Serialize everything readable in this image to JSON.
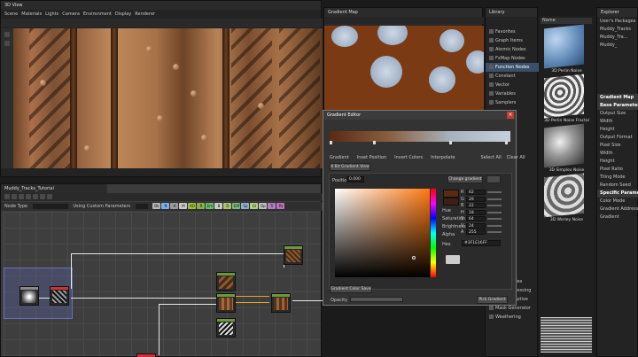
{
  "view3d": {
    "title": "3D View",
    "menu": [
      "Scene",
      "Materials",
      "Lights",
      "Camera",
      "Environment",
      "Display",
      "Renderer"
    ]
  },
  "graph": {
    "title": "Muddy_Tracks_Tutorial",
    "mode_label": "Node Type",
    "params_label": "Using Custom Parameters",
    "chips": [
      {
        "label": "Bb",
        "color": "#b7b7b7"
      },
      {
        "label": "N",
        "color": "#7ab0e8"
      },
      {
        "label": "H",
        "color": "#9b9b9b"
      },
      {
        "label": "M",
        "color": "#c9c9c9"
      },
      {
        "label": "AO",
        "color": "#a0c040"
      },
      {
        "label": "R",
        "color": "#8ab04a"
      },
      {
        "label": "Em",
        "color": "#6dbf6d"
      },
      {
        "label": "B",
        "color": "#c8c8c8"
      },
      {
        "label": "D",
        "color": "#a6c56e"
      },
      {
        "label": "Diff",
        "color": "#7dbb7d"
      },
      {
        "label": "Sp",
        "color": "#90b0d0"
      },
      {
        "label": "Gl",
        "color": "#b0d080"
      },
      {
        "label": "Op",
        "color": "#c0c0c0"
      },
      {
        "label": "Tr",
        "color": "#b080c0"
      },
      {
        "label": "Pa",
        "color": "#c070c0"
      }
    ]
  },
  "gradient_map": {
    "title": "Gradient Map"
  },
  "dialog": {
    "title": "Gradient Editor",
    "tabs": [
      "Gradient",
      "Inset Position",
      "Invert Colors",
      "Interpolate"
    ],
    "right_buttons": [
      "Select All",
      "Clear All"
    ],
    "hdr_button": "8 Bit Gradient View",
    "position_label": "Position",
    "position_value": "0.000",
    "copy_button": "Change gradient color",
    "rows": [
      {
        "label": "R",
        "value": "62"
      },
      {
        "label": "G",
        "value": "29"
      },
      {
        "label": "B",
        "value": "22"
      },
      {
        "label": "H",
        "value": "18"
      },
      {
        "label": "S",
        "value": "64"
      },
      {
        "label": "V",
        "value": "24"
      },
      {
        "label": "A",
        "value": "255"
      }
    ],
    "side_labels": [
      "Hue",
      "Saturation",
      "Brightness",
      "Alpha"
    ],
    "hex_label": "Hex",
    "hex_value": "#3F1E16FF",
    "save_button": "Gradient Color Save",
    "pick_button": "Pick Gradient",
    "slider_label": "Opacity"
  },
  "library": {
    "title": "Library",
    "items": [
      {
        "label": "Favorites",
        "hl": false
      },
      {
        "label": "Graph Items",
        "hl": false
      },
      {
        "label": "Atomic Nodes",
        "hl": false
      },
      {
        "label": "FxMap Nodes",
        "hl": false
      },
      {
        "label": "Function Nodes",
        "hl": true
      },
      {
        "label": "Constant",
        "hl": false
      },
      {
        "label": "Vector",
        "hl": false
      },
      {
        "label": "Variables",
        "hl": false
      },
      {
        "label": "Samplers",
        "hl": false
      },
      {
        "label": "PBR Utilities",
        "hl": false
      },
      {
        "label": "Scan Processing",
        "hl": false
      },
      {
        "label": "Mesh Adaptive",
        "hl": false
      },
      {
        "label": "Mask Generator",
        "hl": false
      },
      {
        "label": "Weathering",
        "hl": false
      }
    ],
    "search_label": "Name",
    "thumbs": [
      {
        "label": "3D Perlin Noise"
      },
      {
        "label": "3D Perlin Noise Fractal"
      },
      {
        "label": "3D Simplex Noise"
      },
      {
        "label": "3D Worley Noise"
      }
    ]
  },
  "explorer": {
    "title": "Explorer",
    "rows": [
      {
        "label": "User's Packages",
        "sec": false
      },
      {
        "label": "Muddy_Tracks",
        "sec": false
      },
      {
        "label": "Muddy_Tra...",
        "sec": false
      },
      {
        "label": "Muddy_",
        "sec": false
      },
      {
        "label": "Gradient Map",
        "sec": true
      },
      {
        "label": "Base Parameters",
        "sec": true
      },
      {
        "label": "Output Size",
        "sec": false
      },
      {
        "label": "Width",
        "sec": false
      },
      {
        "label": "Height",
        "sec": false
      },
      {
        "label": "Output Format",
        "sec": false
      },
      {
        "label": "Pixel Size",
        "sec": false
      },
      {
        "label": "Width",
        "sec": false
      },
      {
        "label": "Height",
        "sec": false
      },
      {
        "label": "Pixel Ratio",
        "sec": false
      },
      {
        "label": "Tiling Mode",
        "sec": false
      },
      {
        "label": "Random Seed",
        "sec": false
      },
      {
        "label": "Specific Parameters",
        "sec": true
      },
      {
        "label": "Color Mode",
        "sec": false
      },
      {
        "label": "Gradient Address",
        "sec": false
      },
      {
        "label": "Gradient",
        "sec": false
      }
    ]
  }
}
